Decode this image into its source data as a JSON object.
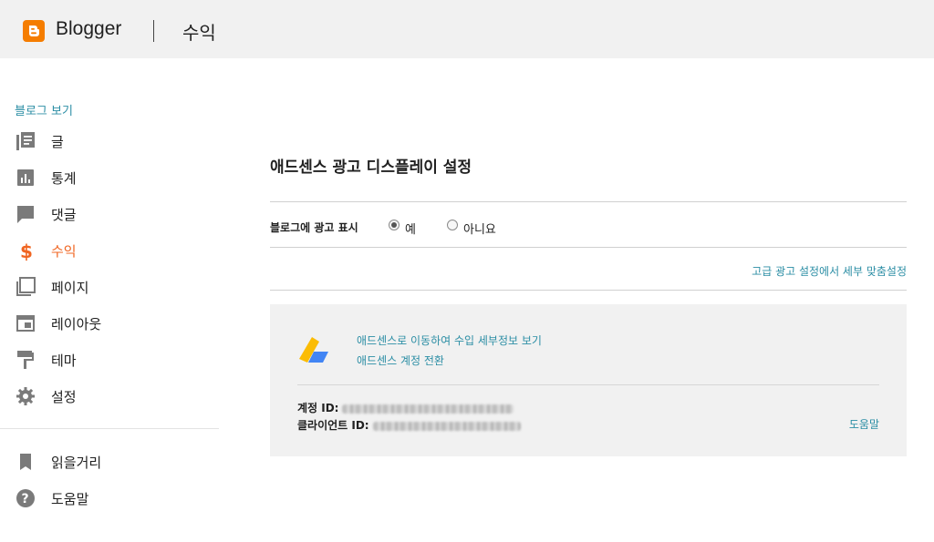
{
  "header": {
    "brand": "Blogger",
    "page_title": "수익",
    "brand_color": "#f57d00"
  },
  "sidebar": {
    "view_blog": "블로그 보기",
    "items": [
      {
        "label": "글",
        "icon": "posts-icon"
      },
      {
        "label": "통계",
        "icon": "stats-icon"
      },
      {
        "label": "댓글",
        "icon": "comments-icon"
      },
      {
        "label": "수익",
        "icon": "dollar-icon",
        "active": true
      },
      {
        "label": "페이지",
        "icon": "pages-icon"
      },
      {
        "label": "레이아웃",
        "icon": "layout-icon"
      },
      {
        "label": "테마",
        "icon": "theme-icon"
      },
      {
        "label": "설정",
        "icon": "gear-icon"
      }
    ],
    "bottom_items": [
      {
        "label": "읽을거리",
        "icon": "bookmark-icon"
      },
      {
        "label": "도움말",
        "icon": "help-icon"
      }
    ],
    "active_color": "#f06521"
  },
  "main": {
    "heading": "애드센스 광고 디스플레이 설정",
    "show_ads_label": "블로그에 광고 표시",
    "options": [
      {
        "label": "예",
        "checked": true
      },
      {
        "label": "아니요",
        "checked": false
      }
    ],
    "advanced_link": "고급 광고 설정에서 세부 맞춤설정",
    "adsense": {
      "link_view_income": "애드센스로 이동하여 수입 세부정보 보기",
      "link_switch_account": "애드센스 계정 전환",
      "account_id_label": "계정 ID:",
      "client_id_label": "클라이언트 ID:",
      "help": "도움말"
    },
    "link_color": "#2c8ea5"
  }
}
